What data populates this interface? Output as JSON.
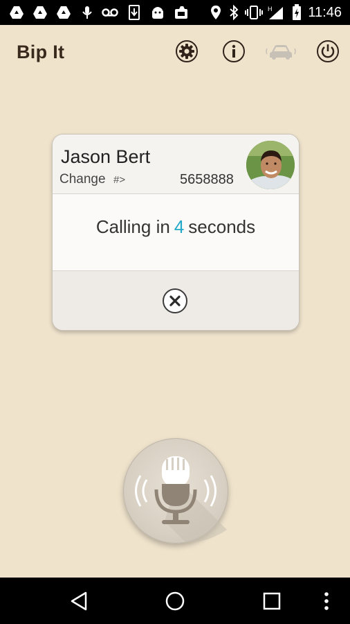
{
  "status_bar": {
    "time": "11:46",
    "icons": [
      "drive-icon",
      "drive-icon",
      "drive-icon",
      "mic-notification-icon",
      "voicemail-icon",
      "download-icon",
      "android-icon",
      "photos-icon",
      "location-icon",
      "bluetooth-icon",
      "vibrate-icon",
      "signal-h-icon",
      "battery-charging-icon"
    ]
  },
  "app_bar": {
    "title": "Bip It",
    "actions": [
      "settings-icon",
      "info-icon",
      "car-icon",
      "power-icon"
    ]
  },
  "call_card": {
    "contact_name": "Jason Bert",
    "change_label": "Change",
    "change_suffix": "#>",
    "phone_number": "5658888",
    "calling_prefix": "Calling in",
    "countdown": "4",
    "calling_suffix": "seconds"
  },
  "colors": {
    "background": "#efe3cc",
    "countdown": "#21a8c9",
    "title": "#3a2a1e"
  },
  "navigation": [
    "back-icon",
    "home-icon",
    "recents-icon",
    "overflow-menu-icon"
  ]
}
